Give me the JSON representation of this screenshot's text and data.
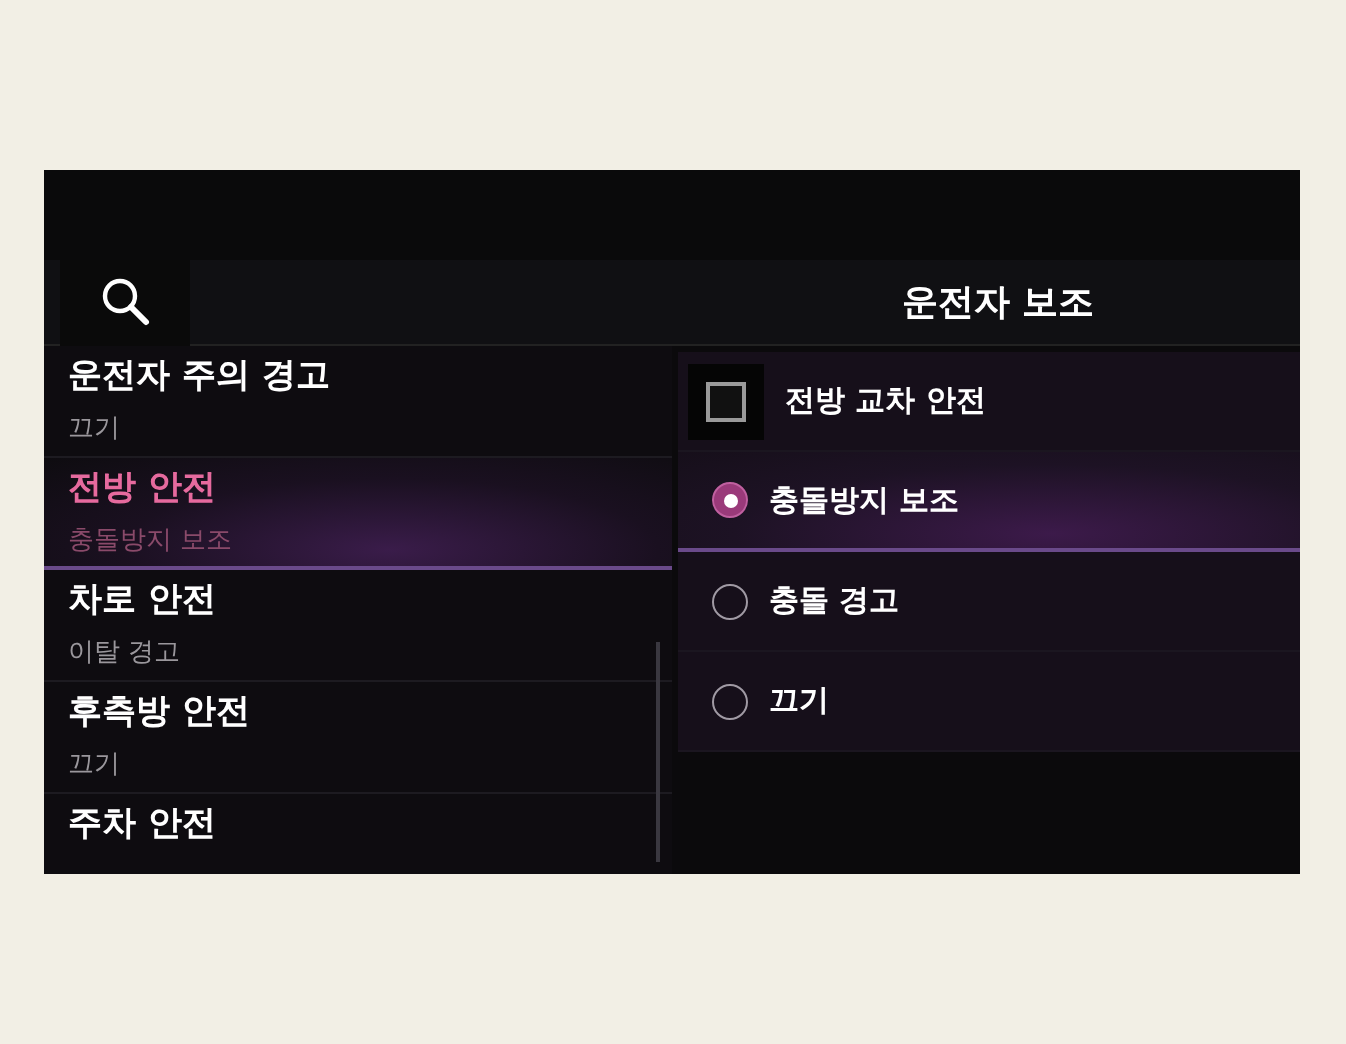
{
  "header": {
    "title": "운전자 보조"
  },
  "menu": [
    {
      "title": "운전자 주의 경고",
      "value": "끄기",
      "selected": false
    },
    {
      "title": "전방 안전",
      "value": "충돌방지 보조",
      "selected": true
    },
    {
      "title": "차로 안전",
      "value": "이탈 경고",
      "selected": false
    },
    {
      "title": "후측방 안전",
      "value": "끄기",
      "selected": false
    },
    {
      "title": "주차 안전",
      "selected": false
    }
  ],
  "options": [
    {
      "kind": "checkbox",
      "label": "전방 교차 안전",
      "checked": false
    },
    {
      "kind": "radio",
      "label": "충돌방지 보조",
      "selected": true
    },
    {
      "kind": "radio",
      "label": "충돌 경고",
      "selected": false
    },
    {
      "kind": "radio",
      "label": "끄기",
      "selected": false
    }
  ]
}
